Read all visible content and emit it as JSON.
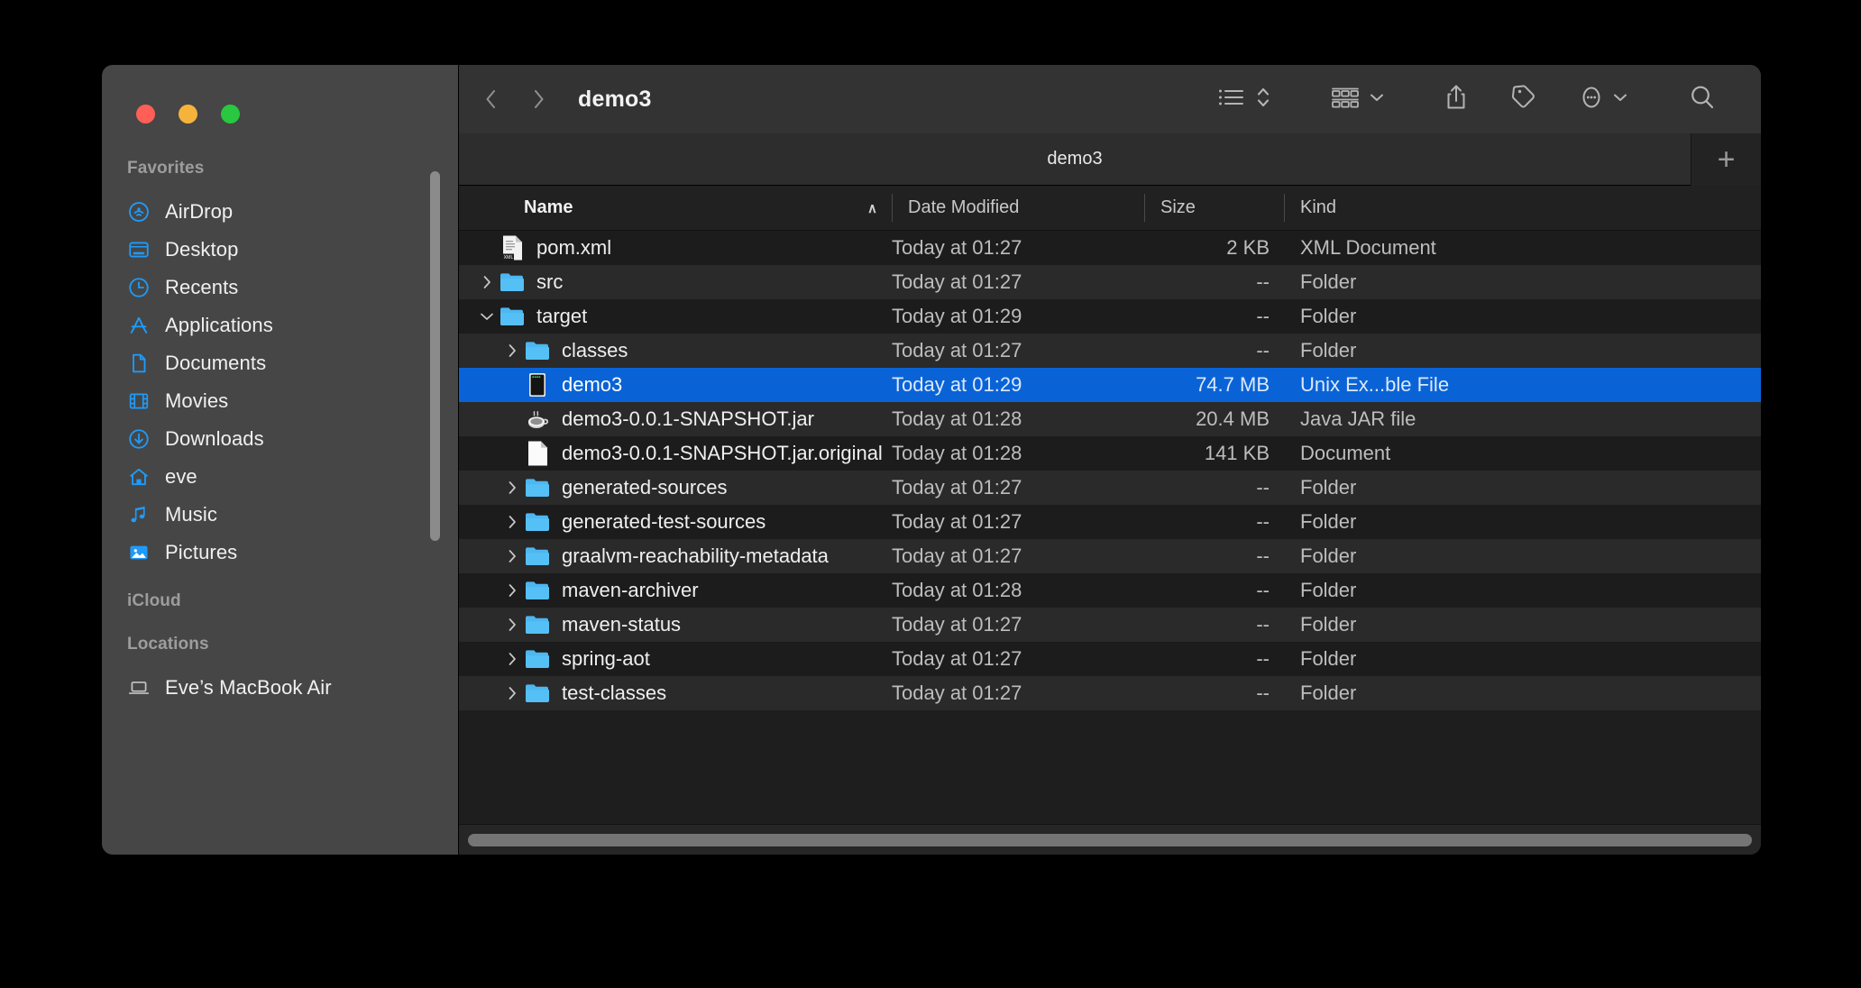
{
  "window": {
    "title": "demo3",
    "traffic_lights": [
      {
        "name": "close",
        "color": "#ff5f57"
      },
      {
        "name": "minimize",
        "color": "#f6b33c"
      },
      {
        "name": "maximize",
        "color": "#28c840"
      }
    ]
  },
  "toolbar": {
    "back_icon": "chevron-left-icon",
    "forward_icon": "chevron-right-icon",
    "view_list_icon": "list-view-icon",
    "view_sort_icon": "sort-updown-icon",
    "group_icon": "group-by-icon",
    "group_chevron": "chevron-down-icon",
    "share_icon": "share-icon",
    "tag_icon": "tag-icon",
    "more_icon": "more-ellipsis-icon",
    "more_chevron": "chevron-down-icon",
    "search_icon": "search-icon"
  },
  "tabbar": {
    "active_tab": "demo3",
    "new_tab_label": "+"
  },
  "sidebar": {
    "groups": [
      {
        "title": "Favorites",
        "items": [
          {
            "label": "AirDrop",
            "icon": "airdrop-icon"
          },
          {
            "label": "Desktop",
            "icon": "desktop-icon"
          },
          {
            "label": "Recents",
            "icon": "clock-icon"
          },
          {
            "label": "Applications",
            "icon": "applications-icon"
          },
          {
            "label": "Documents",
            "icon": "document-icon"
          },
          {
            "label": "Movies",
            "icon": "film-icon"
          },
          {
            "label": "Downloads",
            "icon": "download-icon"
          },
          {
            "label": "eve",
            "icon": "home-icon"
          },
          {
            "label": "Music",
            "icon": "music-note-icon"
          },
          {
            "label": "Pictures",
            "icon": "pictures-icon"
          }
        ]
      },
      {
        "title": "iCloud",
        "items": []
      },
      {
        "title": "Locations",
        "items": [
          {
            "label": "Eve’s MacBook Air",
            "icon": "laptop-icon"
          }
        ]
      }
    ]
  },
  "columns": {
    "name": "Name",
    "date_modified": "Date Modified",
    "size": "Size",
    "kind": "Kind",
    "sort_indicator": "∧"
  },
  "files": [
    {
      "name": "pom.xml",
      "date": "Today at 01:27",
      "size": "2 KB",
      "kind": "XML Document",
      "icon": "xml-file-icon",
      "indent": 0,
      "disclosure": "none",
      "selected": false
    },
    {
      "name": "src",
      "date": "Today at 01:27",
      "size": "--",
      "kind": "Folder",
      "icon": "folder-icon",
      "indent": 0,
      "disclosure": "collapsed",
      "selected": false
    },
    {
      "name": "target",
      "date": "Today at 01:29",
      "size": "--",
      "kind": "Folder",
      "icon": "folder-icon",
      "indent": 0,
      "disclosure": "expanded",
      "selected": false
    },
    {
      "name": "classes",
      "date": "Today at 01:27",
      "size": "--",
      "kind": "Folder",
      "icon": "folder-icon",
      "indent": 1,
      "disclosure": "collapsed",
      "selected": false
    },
    {
      "name": "demo3",
      "date": "Today at 01:29",
      "size": "74.7 MB",
      "kind": "Unix Ex...ble File",
      "icon": "unix-executable-icon",
      "indent": 1,
      "disclosure": "none",
      "selected": true
    },
    {
      "name": "demo3-0.0.1-SNAPSHOT.jar",
      "date": "Today at 01:28",
      "size": "20.4 MB",
      "kind": "Java JAR file",
      "icon": "java-jar-icon",
      "indent": 1,
      "disclosure": "none",
      "selected": false
    },
    {
      "name": "demo3-0.0.1-SNAPSHOT.jar.original",
      "date": "Today at 01:28",
      "size": "141 KB",
      "kind": "Document",
      "icon": "blank-document-icon",
      "indent": 1,
      "disclosure": "none",
      "selected": false
    },
    {
      "name": "generated-sources",
      "date": "Today at 01:27",
      "size": "--",
      "kind": "Folder",
      "icon": "folder-icon",
      "indent": 1,
      "disclosure": "collapsed",
      "selected": false
    },
    {
      "name": "generated-test-sources",
      "date": "Today at 01:27",
      "size": "--",
      "kind": "Folder",
      "icon": "folder-icon",
      "indent": 1,
      "disclosure": "collapsed",
      "selected": false
    },
    {
      "name": "graalvm-reachability-metadata",
      "date": "Today at 01:27",
      "size": "--",
      "kind": "Folder",
      "icon": "folder-icon",
      "indent": 1,
      "disclosure": "collapsed",
      "selected": false
    },
    {
      "name": "maven-archiver",
      "date": "Today at 01:28",
      "size": "--",
      "kind": "Folder",
      "icon": "folder-icon",
      "indent": 1,
      "disclosure": "collapsed",
      "selected": false
    },
    {
      "name": "maven-status",
      "date": "Today at 01:27",
      "size": "--",
      "kind": "Folder",
      "icon": "folder-icon",
      "indent": 1,
      "disclosure": "collapsed",
      "selected": false
    },
    {
      "name": "spring-aot",
      "date": "Today at 01:27",
      "size": "--",
      "kind": "Folder",
      "icon": "folder-icon",
      "indent": 1,
      "disclosure": "collapsed",
      "selected": false
    },
    {
      "name": "test-classes",
      "date": "Today at 01:27",
      "size": "--",
      "kind": "Folder",
      "icon": "folder-icon",
      "indent": 1,
      "disclosure": "collapsed",
      "selected": false
    }
  ],
  "colors": {
    "selection": "#0a63d6",
    "sidebar_bg": "#464646",
    "content_bg": "#1e1e1e",
    "toolbar_bg": "#333333",
    "accent_blue": "#1e9bfa",
    "folder_blue": "#4cb7f0"
  }
}
